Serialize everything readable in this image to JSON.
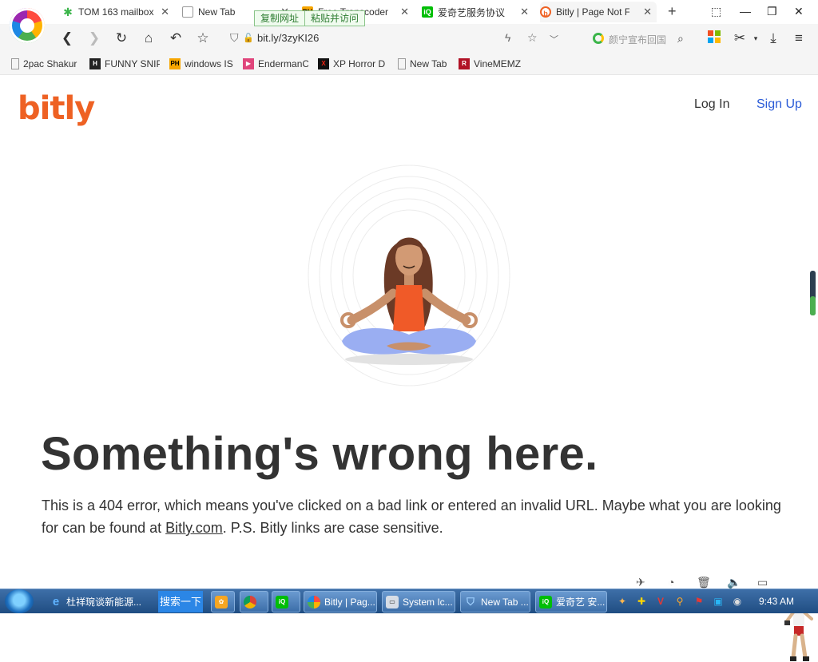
{
  "browser": {
    "tabs": [
      {
        "title": "TOM 163 mailbox",
        "favicon": "clover-icon",
        "color": "#3bb54a"
      },
      {
        "title": "New Tab",
        "favicon": "page-grid-icon",
        "color": "#777777"
      },
      {
        "title": "Free Transcoder",
        "favicon": "ph-icon",
        "color": "#f7a600"
      },
      {
        "title": "爱奇艺服务协议",
        "favicon": "iqiyi-icon",
        "color": "#00be06"
      },
      {
        "title": "Bitly | Page Not Fo",
        "favicon": "bitly-icon",
        "color": "#ee6123",
        "active": true
      }
    ],
    "copy_popup": {
      "copy_url": "复制网址",
      "paste_visit": "粘贴并访问"
    },
    "address": {
      "url": "bit.ly/3zyKI26"
    },
    "search": {
      "placeholder": "颜宁宣布回国"
    },
    "bookmarks": [
      {
        "label": "2pac Shakur",
        "icon": "page-icon",
        "color": "#888888"
      },
      {
        "label": "FUNNY SNIP",
        "icon": "h-icon",
        "color": "#222222"
      },
      {
        "label": "windows IS",
        "icon": "ph-icon",
        "color": "#f7a600"
      },
      {
        "label": "EndermanC",
        "icon": "ytb-icon",
        "color": "#e0457b"
      },
      {
        "label": "XP Horror D",
        "icon": "x-icon",
        "color": "#b00000"
      },
      {
        "label": "New Tab",
        "icon": "page-icon",
        "color": "#888888"
      },
      {
        "label": "VineMEMZ",
        "icon": "r-icon",
        "color": "#b11226"
      }
    ]
  },
  "page": {
    "brand": "bitly",
    "nav": {
      "login": "Log In",
      "signup": "Sign Up"
    },
    "headline": "Something's wrong here.",
    "body_before": "This is a 404 error, which means you've clicked on a bad link or entered an invalid URL. Maybe what you are looking for can be found at ",
    "body_link": "Bitly.com",
    "body_after": ". P.S. Bitly links are case sensitive.",
    "colors": {
      "brand": "#ee6123",
      "signup": "#2a5bd7",
      "headline": "#333333"
    }
  },
  "taskbar": {
    "items": [
      {
        "label": "杜祥琬谈新能源...",
        "icon": "ie-icon"
      },
      {
        "label": "搜索一下",
        "icon": "search-icon"
      },
      {
        "label": "Bitly | Pag...",
        "icon": "browser-icon"
      },
      {
        "label": "System Ic...",
        "icon": "system-icon"
      },
      {
        "label": "New Tab ...",
        "icon": "shield-icon"
      },
      {
        "label": "爱奇艺 安...",
        "icon": "iqiyi-icon"
      }
    ],
    "clock": "9:43 AM"
  }
}
